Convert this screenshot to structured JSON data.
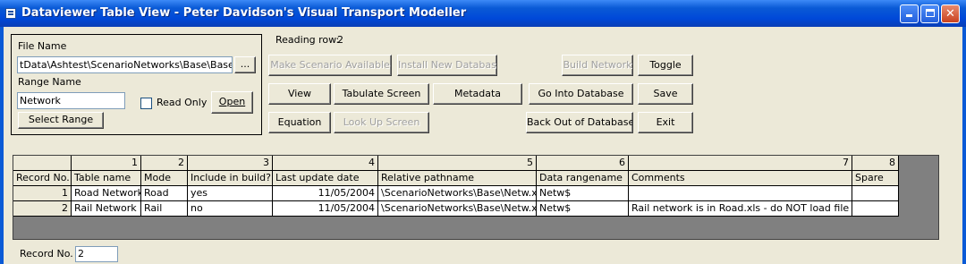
{
  "window": {
    "title": "Dataviewer Table View - Peter Davidson's Visual Transport Modeller",
    "controls": [
      "minimize",
      "maximize",
      "close"
    ]
  },
  "file_group": {
    "file_name_label": "File Name",
    "file_name_value": "tData\\Ashtest\\ScenarioNetworks\\Base\\Base.xls",
    "browse_label": "...",
    "range_name_label": "Range Name",
    "range_name_value": "Network",
    "read_only_label": "Read Only",
    "read_only_checked": false,
    "open_label": "Open",
    "select_range_label": "Select Range"
  },
  "reading_row_label": "Reading row:",
  "reading_row_value": "2",
  "buttons": {
    "make_scenario": "Make Scenario Available",
    "install_db": "Install New Database",
    "build_network": "Build Network",
    "toggle": "Toggle",
    "view": "View",
    "tabulate": "Tabulate Screen",
    "metadata": "Metadata",
    "go_into_db": "Go Into Database",
    "save": "Save",
    "equation": "Equation",
    "look_up": "Look Up Screen",
    "back_out": "Back Out of Database",
    "exit": "Exit"
  },
  "table": {
    "col_numbers": [
      "",
      "1",
      "2",
      "3",
      "4",
      "5",
      "6",
      "7",
      "8"
    ],
    "headers": [
      "Record No.",
      "Table name",
      "Mode",
      "Include in build?",
      "Last update date",
      "Relative pathname",
      "Data rangename",
      "Comments",
      "Spare"
    ],
    "rows": [
      [
        "1",
        "Road Network",
        "Road",
        "yes",
        "11/05/2004",
        "\\ScenarioNetworks\\Base\\Netw.xls",
        "Netw$",
        "",
        ""
      ],
      [
        "2",
        "Rail Network",
        "Rail",
        "no",
        "11/05/2004",
        "\\ScenarioNetworks\\Base\\Netw.xls",
        "Netw$",
        "Rail network is in Road.xls - do NOT load file twice",
        ""
      ]
    ]
  },
  "record_no_label": "Record No.",
  "record_no_value": "2"
}
